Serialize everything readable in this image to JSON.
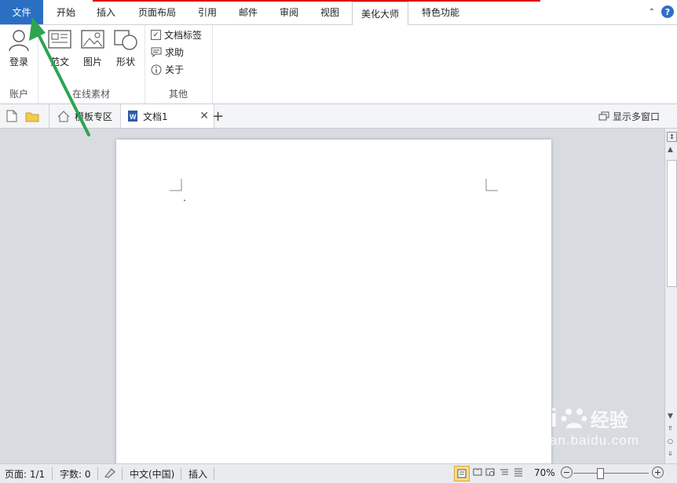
{
  "menu": {
    "file_label": "文件",
    "tabs": [
      "开始",
      "插入",
      "页面布局",
      "引用",
      "邮件",
      "审阅",
      "视图",
      "美化大师",
      "特色功能"
    ]
  },
  "ribbon": {
    "groups": {
      "account": {
        "label": "账户",
        "login_label": "登录"
      },
      "online_material": {
        "label": "在线素材",
        "items": [
          "范文",
          "图片",
          "形状"
        ]
      },
      "other": {
        "label": "其他",
        "checkbox_label": "文档标签",
        "help_label": "求助",
        "about_label": "关于"
      }
    }
  },
  "doc_tabs": {
    "template_zone": "模板专区",
    "doc_name": "文档1",
    "multi_window": "显示多窗口"
  },
  "statusbar": {
    "page": "页面: 1/1",
    "words": "字数: 0",
    "language": "中文(中国)",
    "mode": "插入",
    "zoom": "70%"
  },
  "watermark": {
    "brand": "Bai",
    "brand2": "经验",
    "url": "jingyan.baidu.com"
  },
  "colors": {
    "file_tab": "#2b6fc4",
    "arrow": "#2ea44f",
    "accent_red": "#e00000",
    "help": "#2f6fc6"
  }
}
